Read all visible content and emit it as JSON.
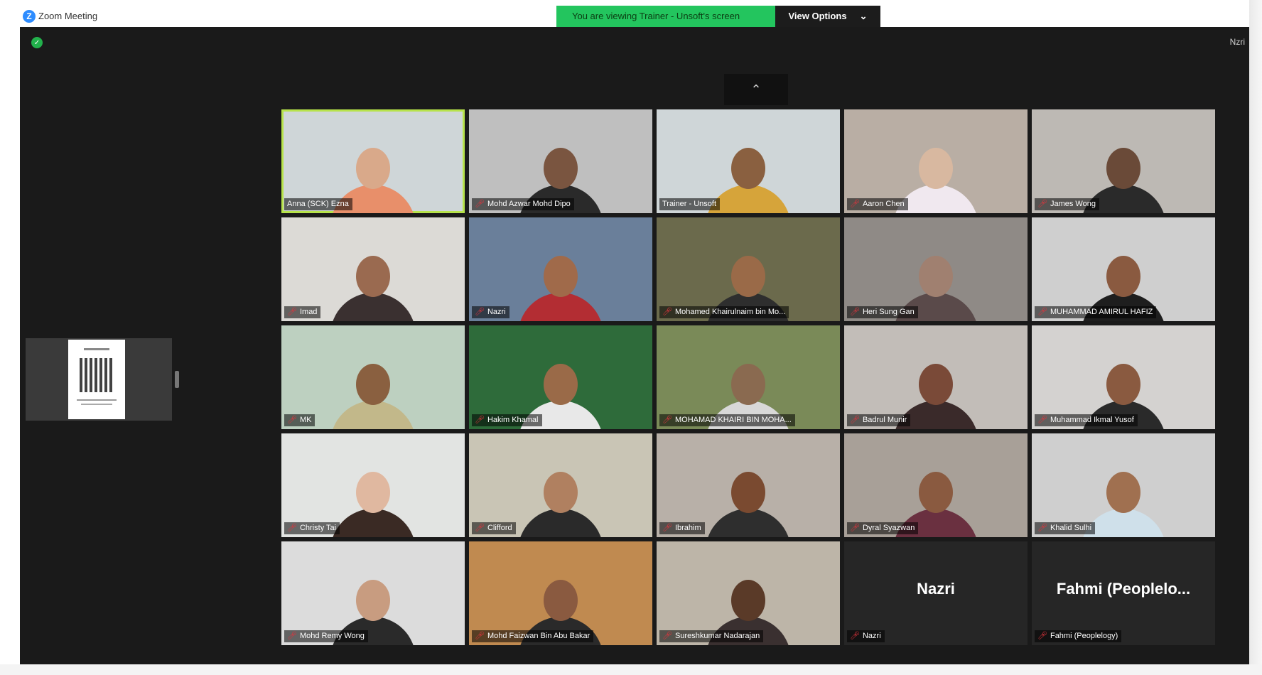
{
  "window": {
    "title": "Zoom Meeting",
    "top_right_label": "Nzri"
  },
  "share_banner": {
    "text": "You are viewing Trainer - Unsoft's screen",
    "view_options": "View Options",
    "dropdown_glyph": "⌄"
  },
  "pager": {
    "up_glyph": "⌃"
  },
  "icons": {
    "app": "zoom-logo-icon",
    "encryption": "shield-icon",
    "muted": "mic-muted-icon"
  },
  "colors": {
    "banner_green": "#23c55e",
    "active_speaker": "#b7e34b",
    "muted_red": "#e0333c",
    "background": "#1a1a1a"
  },
  "participants": [
    {
      "name": "Anna (SCK) Ezna",
      "muted": false,
      "active": true,
      "bg": "#cfd6d8",
      "skin": "#d9a98a",
      "shirt": "#e88f6a"
    },
    {
      "name": "Mohd Azwar Mohd Dipo",
      "muted": true,
      "active": false,
      "bg": "#bfbfbf",
      "skin": "#7a5540",
      "shirt": "#2a2a2a"
    },
    {
      "name": "Trainer - Unsoft",
      "muted": false,
      "active": false,
      "bg": "#cfd6d8",
      "skin": "#8a6040",
      "shirt": "#d6a43a"
    },
    {
      "name": "Aaron Chen",
      "muted": true,
      "active": false,
      "bg": "#b9aea4",
      "skin": "#d8b8a0",
      "shirt": "#f0e8ef"
    },
    {
      "name": "James Wong",
      "muted": true,
      "active": false,
      "bg": "#bdb9b4",
      "skin": "#6a4a38",
      "shirt": "#2a2a2a"
    },
    {
      "name": "Imad",
      "muted": true,
      "active": false,
      "bg": "#dcdad6",
      "skin": "#9a6a50",
      "shirt": "#3a3030"
    },
    {
      "name": "Nazri",
      "muted": true,
      "active": false,
      "bg": "#6a7f9a",
      "skin": "#a06a4a",
      "shirt": "#b32d33"
    },
    {
      "name": "Mohamed Khairulnaim bin Mo...",
      "muted": true,
      "active": false,
      "bg": "#6b6a4c",
      "skin": "#9a6a48",
      "shirt": "#2e2e2e"
    },
    {
      "name": "Heri Sung Gan",
      "muted": true,
      "active": false,
      "bg": "#8f8a86",
      "skin": "#a08070",
      "shirt": "#5a4a4a"
    },
    {
      "name": "MUHAMMAD AMIRUL HAFIZ",
      "muted": true,
      "active": false,
      "bg": "#cfcfcf",
      "skin": "#8a5a40",
      "shirt": "#1e1e1e"
    },
    {
      "name": "MK",
      "muted": true,
      "active": false,
      "bg": "#bdd0c0",
      "skin": "#8a6040",
      "shirt": "#c2b88a"
    },
    {
      "name": "Hakim Khamal",
      "muted": true,
      "active": false,
      "bg": "#2e6b3a",
      "skin": "#9a6a48",
      "shirt": "#e8e8e8"
    },
    {
      "name": "MOHAMAD KHAIRI BIN MOHA...",
      "muted": true,
      "active": false,
      "bg": "#7a8a58",
      "skin": "#8a6a50",
      "shirt": "#d8d8d8"
    },
    {
      "name": "Badrul Munir",
      "muted": true,
      "active": false,
      "bg": "#c2bdb8",
      "skin": "#7a4a38",
      "shirt": "#3a2a2a"
    },
    {
      "name": "Muhammad Ikmal Yusof",
      "muted": true,
      "active": false,
      "bg": "#d4d2d0",
      "skin": "#8a5a40",
      "shirt": "#2a2a2a"
    },
    {
      "name": "Christy Tai",
      "muted": true,
      "active": false,
      "bg": "#e2e4e2",
      "skin": "#e0b8a0",
      "shirt": "#3a2a24"
    },
    {
      "name": "Clifford",
      "muted": true,
      "active": false,
      "bg": "#c9c5b5",
      "skin": "#b08060",
      "shirt": "#2a2a2a"
    },
    {
      "name": "Ibrahim",
      "muted": true,
      "active": false,
      "bg": "#b8b0a8",
      "skin": "#7a4a30",
      "shirt": "#2e2e2e"
    },
    {
      "name": "Dyral Syazwan",
      "muted": true,
      "active": false,
      "bg": "#a8a098",
      "skin": "#8a5a40",
      "shirt": "#6a3040"
    },
    {
      "name": "Khalid Sulhi",
      "muted": true,
      "active": false,
      "bg": "#cfcfcf",
      "skin": "#a07050",
      "shirt": "#cfe0ea"
    },
    {
      "name": "Mohd Remy Wong",
      "muted": true,
      "active": false,
      "bg": "#dcdcdc",
      "skin": "#c89c80",
      "shirt": "#2a2a2a"
    },
    {
      "name": "Mohd Faizwan Bin Abu Bakar",
      "muted": true,
      "active": false,
      "bg": "#c08a50",
      "skin": "#8a5a40",
      "shirt": "#2a2a2a"
    },
    {
      "name": "Sureshkumar Nadarajan",
      "muted": true,
      "active": false,
      "bg": "#bdb5a8",
      "skin": "#5a3a28",
      "shirt": "#3a3030"
    },
    {
      "name": "Nazri",
      "display_name": "Nazri",
      "muted": true,
      "active": false,
      "video_off": true
    },
    {
      "name": "Fahmi (Peoplelogy)",
      "display_name": "Fahmi (Peoplelo...",
      "muted": true,
      "active": false,
      "video_off": true
    }
  ]
}
